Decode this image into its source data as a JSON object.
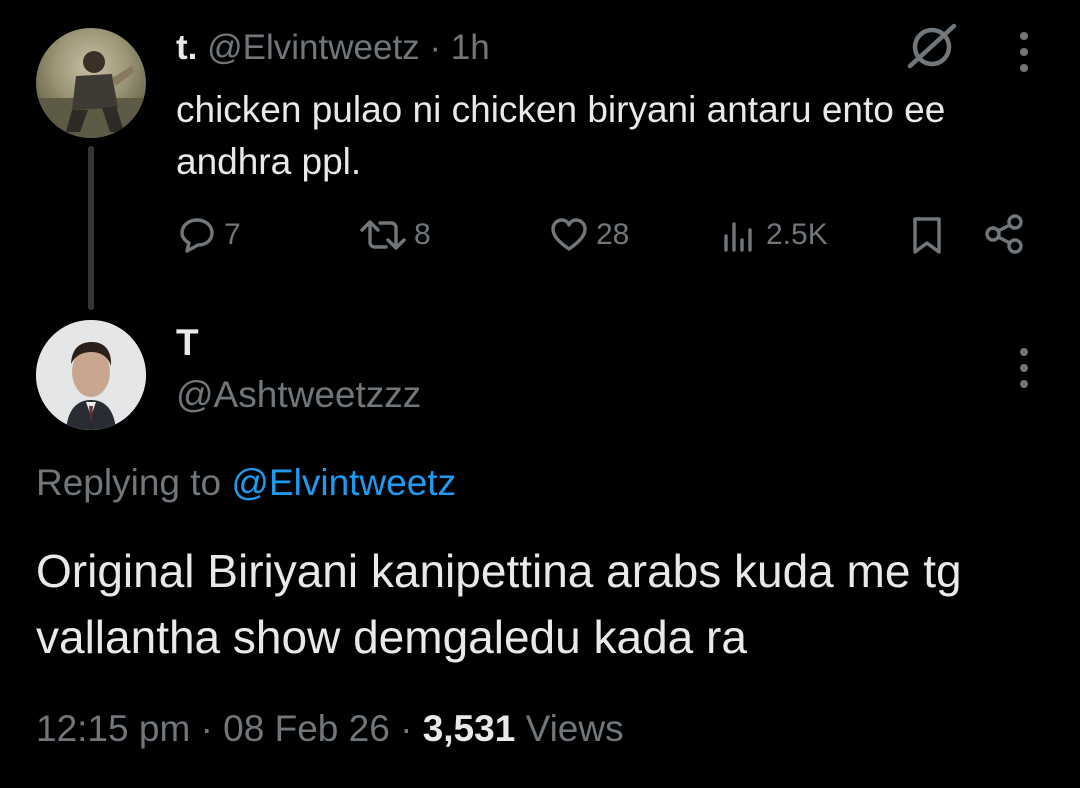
{
  "parent_tweet": {
    "display_name": "t.",
    "handle": "@Elvintweetz",
    "time": "1h",
    "text": "chicken pulao ni chicken biryani antaru ento ee andhra ppl.",
    "actions": {
      "replies": "7",
      "reposts": "8",
      "likes": "28",
      "views": "2.5K"
    },
    "icons": [
      "grok-icon",
      "more-icon",
      "reply-icon",
      "repost-icon",
      "like-icon",
      "views-icon",
      "bookmark-icon",
      "share-icon"
    ]
  },
  "reply_tweet": {
    "display_name": "T",
    "handle": "@Ashtweetzzz",
    "replying_to_label": "Replying to",
    "replying_to_handle": "@Elvintweetz",
    "text": "Original Biriyani kanipettina arabs kuda me tg vallantha show demgaledu kada ra",
    "time": "12:15 pm",
    "date": "08 Feb 26",
    "views_count": "3,531",
    "views_label": "Views"
  },
  "separator": "·",
  "colors": {
    "background": "#000000",
    "text": "#e7e9ea",
    "muted": "#71767b",
    "link": "#1d9bf0"
  }
}
